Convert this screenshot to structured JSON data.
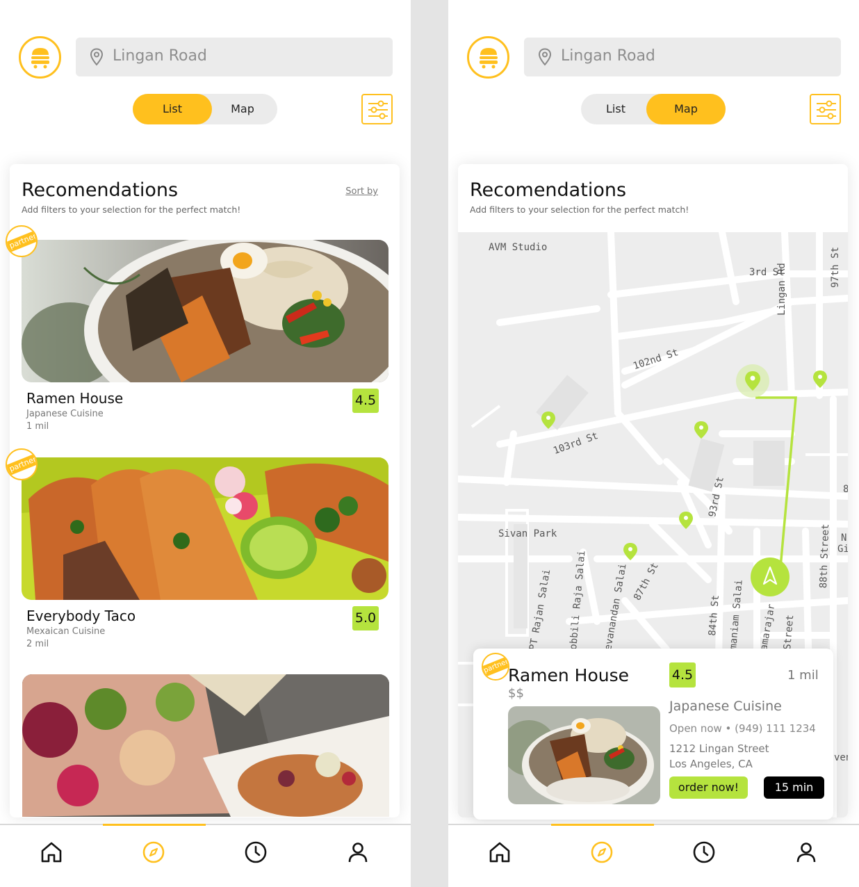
{
  "search": {
    "value": "Lingan Road"
  },
  "toggle": {
    "list_label": "List",
    "map_label": "Map"
  },
  "section": {
    "title": "Recomendations",
    "subtitle": "Add filters to your selection for the perfect match!",
    "sort_label": "Sort by"
  },
  "badge_text": "partner",
  "restaurants": [
    {
      "name": "Ramen House",
      "cuisine": "Japanese Cuisine",
      "distance": "1 mil",
      "rating": "4.5",
      "partner": true
    },
    {
      "name": "Everybody Taco",
      "cuisine": "Mexaican Cuisine",
      "distance": "2 mil",
      "rating": "5.0",
      "partner": true
    },
    {
      "name": "",
      "cuisine": "",
      "distance": "",
      "rating": "",
      "partner": false
    }
  ],
  "map": {
    "labels": [
      "AVM Studio",
      "3rd St",
      "Lingan Rd",
      "97th St",
      "102nd St",
      "103rd St",
      "Sivan Park",
      "93rd St",
      "87th St",
      "88th Street",
      "PT Rajan Salai",
      "obbili Raja Salai",
      "evanandan Salai",
      "84th St",
      "maniam Salai",
      "amarajar",
      "Street",
      "8",
      "N",
      "Gi",
      "ven"
    ]
  },
  "selected": {
    "name": "Ramen House",
    "price": "$$",
    "rating": "4.5",
    "distance": "1 mil",
    "cuisine": "Japanese Cuisine",
    "open_phone": "Open now • (949) 111 1234",
    "address_line1": "1212 Lingan Street",
    "address_line2": "Los Angeles, CA",
    "order_label": "order now!",
    "eta": "15 min"
  },
  "nav": {
    "items": [
      "home-icon",
      "compass-icon",
      "clock-icon",
      "profile-icon"
    ],
    "active": "compass-icon"
  },
  "colors": {
    "accent": "#ffc01e",
    "green": "#b5e33e",
    "background": "#e4e4e4"
  }
}
